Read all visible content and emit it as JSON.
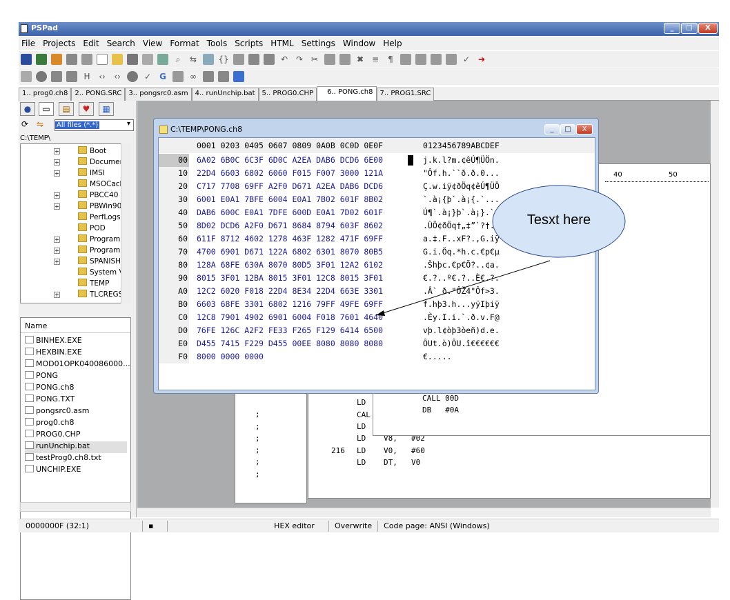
{
  "app": {
    "title": "PSPad"
  },
  "window_buttons": {
    "minimize": "_",
    "maximize": "□",
    "close": "X"
  },
  "menu": [
    "File",
    "Projects",
    "Edit",
    "Search",
    "View",
    "Format",
    "Tools",
    "Scripts",
    "HTML",
    "Settings",
    "Window",
    "Help"
  ],
  "tabs": [
    "1.. prog0.ch8",
    "2.. PONG.SRC",
    "3.. pongsrc0.asm",
    "4.. runUnchip.bat",
    "5.. PROG0.CHP",
    "6.. PONG.ch8",
    "7.. PROG1.SRC"
  ],
  "active_tab": 5,
  "filter": {
    "value": "All files (*.*)"
  },
  "path": "C:\\TEMP\\",
  "tree": [
    "Boot",
    "Documents a",
    "IMSI",
    "MSOCache",
    "PBCC40",
    "PBWin90",
    "PerfLogs",
    "POD",
    "Program Files",
    "ProgramData",
    "SPANISH",
    "System Volur",
    "TEMP",
    "TLCREGS"
  ],
  "file_list_header": "Name",
  "files": [
    "BINHEX.EXE",
    "HEXBIN.EXE",
    "MOD01OPK040086000...",
    "PONG",
    "PONG.ch8",
    "PONG.TXT",
    "pongsrc0.asm",
    "prog0.ch8",
    "PROG0.CHP",
    "runUnchip.bat",
    "testProg0.ch8.txt",
    "UNCHIP.EXE"
  ],
  "hex_window": {
    "title": "C:\\TEMP\\PONG.ch8",
    "header_hex": "0001 0203 0405 0607 0809 0A0B 0C0D 0E0F",
    "header_ascii": "0123456789ABCDEF",
    "rows": [
      {
        "off": "00",
        "hex": "6A02 6B0C 6C3F 6D0C A2EA DAB6 DCD6 6E00",
        "ascii": "j.k.l?m.¢êÚ¶ÜÖn."
      },
      {
        "off": "10",
        "hex": "22D4 6603 6802 6060 F015 F007 3000 121A",
        "ascii": "\"Ôf.h.``ð.ð.0..."
      },
      {
        "off": "20",
        "hex": "C717 7708 69FF A2F0 D671 A2EA DAB6 DCD6",
        "ascii": "Ç.w.iÿ¢ðÖq¢êÚ¶ÜÖ"
      },
      {
        "off": "30",
        "hex": "6001 E0A1 7BFE 6004 E0A1 7B02 601F 8B02",
        "ascii": "`.à¡{þ`.à¡{.`..."
      },
      {
        "off": "40",
        "hex": "DAB6 600C E0A1 7DFE 600D E0A1 7D02 601F",
        "ascii": "Ú¶`.à¡}þ`.à¡}.`."
      },
      {
        "off": "50",
        "hex": "8D02 DCD6 A2F0 D671 8684 8794 603F 8602",
        "ascii": ".ÜÖ¢ðÖq†„‡”`?†."
      },
      {
        "off": "60",
        "hex": "611F 8712 4602 1278 463F 1282 471F 69FF",
        "ascii": "a.‡.F..xF?.‚G.iÿ"
      },
      {
        "off": "70",
        "hex": "4700 6901 D671 122A 6802 6301 8070 80B5",
        "ascii": "G.i.Öq.*h.c.€p€µ"
      },
      {
        "off": "80",
        "hex": "128A 68FE 630A 8070 80D5 3F01 12A2 6102",
        "ascii": ".Šhþc.€p€Õ?..¢a."
      },
      {
        "off": "90",
        "hex": "8015 3F01 12BA 8015 3F01 12C8 8015 3F01",
        "ascii": "€.?..º€.?..È€.?."
      },
      {
        "off": "A0",
        "hex": "12C2 6020 F018 22D4 8E34 22D4 663E 3301",
        "ascii": ".Â` ð.\"ÔŽ4\"Ôf>3."
      },
      {
        "off": "B0",
        "hex": "6603 68FE 3301 6802 1216 79FF 49FE 69FF",
        "ascii": "f.hþ3.h...yÿIþiÿ"
      },
      {
        "off": "C0",
        "hex": "12C8 7901 4902 6901 6004 F018 7601 4640",
        "ascii": ".Èy.I.i.`.ð.v.F@"
      },
      {
        "off": "D0",
        "hex": "76FE 126C A2F2 FE33 F265 F129 6414 6500",
        "ascii": "vþ.l¢òþ3òeñ)d.e."
      },
      {
        "off": "E0",
        "hex": "D455 7415 F229 D455 00EE 8080 8080 8080",
        "ascii": "ÔUt.ò)ÔU.î€€€€€€"
      },
      {
        "off": "F0",
        "hex": "8000 0000 0000",
        "ascii": "€....."
      }
    ]
  },
  "callout": {
    "text": "Tesxt here"
  },
  "ruler": {
    "mark1": "40",
    "mark2": "50"
  },
  "code_bg": {
    "lines": [
      {
        "a": "LD",
        "b": "",
        "c": "CALL 00D"
      },
      {
        "a": "CAL",
        "b": "",
        "c": "DB   #0A"
      },
      {
        "a": "LD",
        "b": "",
        "c": ""
      },
      {
        "a": "LD",
        "b": "V8,",
        "c": "#02"
      },
      {
        "a": "LD",
        "b": "V0,",
        "c": "#60",
        "num": "216"
      },
      {
        "a": "LD",
        "b": "DT,",
        "c": "V0"
      }
    ],
    "semis": [
      ";",
      ";",
      ";",
      ";",
      ";",
      ";"
    ]
  },
  "status": {
    "pos": "0000000F  (32:1)",
    "mode": "HEX editor",
    "overwrite": "Overwrite",
    "codepage": "Code page: ANSI (Windows)"
  },
  "colors": {
    "title_bar": "#3a62aa",
    "hex_text": "#1a1a9a",
    "mdi_bg": "#abacad",
    "callout_fill": "#d5e4f7"
  }
}
